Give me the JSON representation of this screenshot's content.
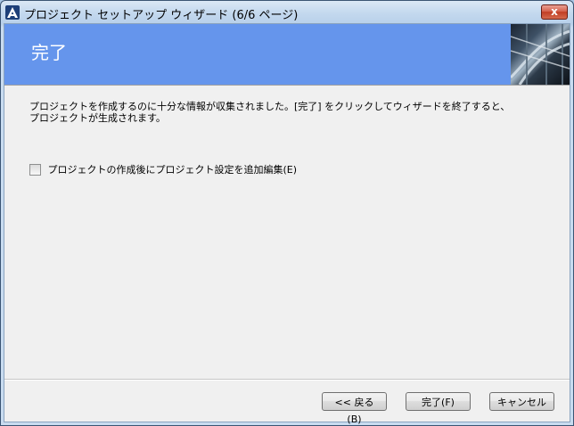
{
  "window": {
    "title": "プロジェクト セットアップ ウィザード (6/6 ページ)",
    "close_label": "x"
  },
  "banner": {
    "title": "完了",
    "background_color": "#6595EC"
  },
  "description": {
    "line1": "プロジェクトを作成するのに十分な情報が収集されました。[完了] をクリックしてウィザードを終了すると、",
    "line2": "プロジェクトが生成されます。"
  },
  "option": {
    "label": "プロジェクトの作成後にプロジェクト設定を追加編集(E)",
    "checked": false
  },
  "buttons": {
    "back": "<< 戻る(B)",
    "finish": "完了(F)",
    "cancel": "キャンセル"
  }
}
